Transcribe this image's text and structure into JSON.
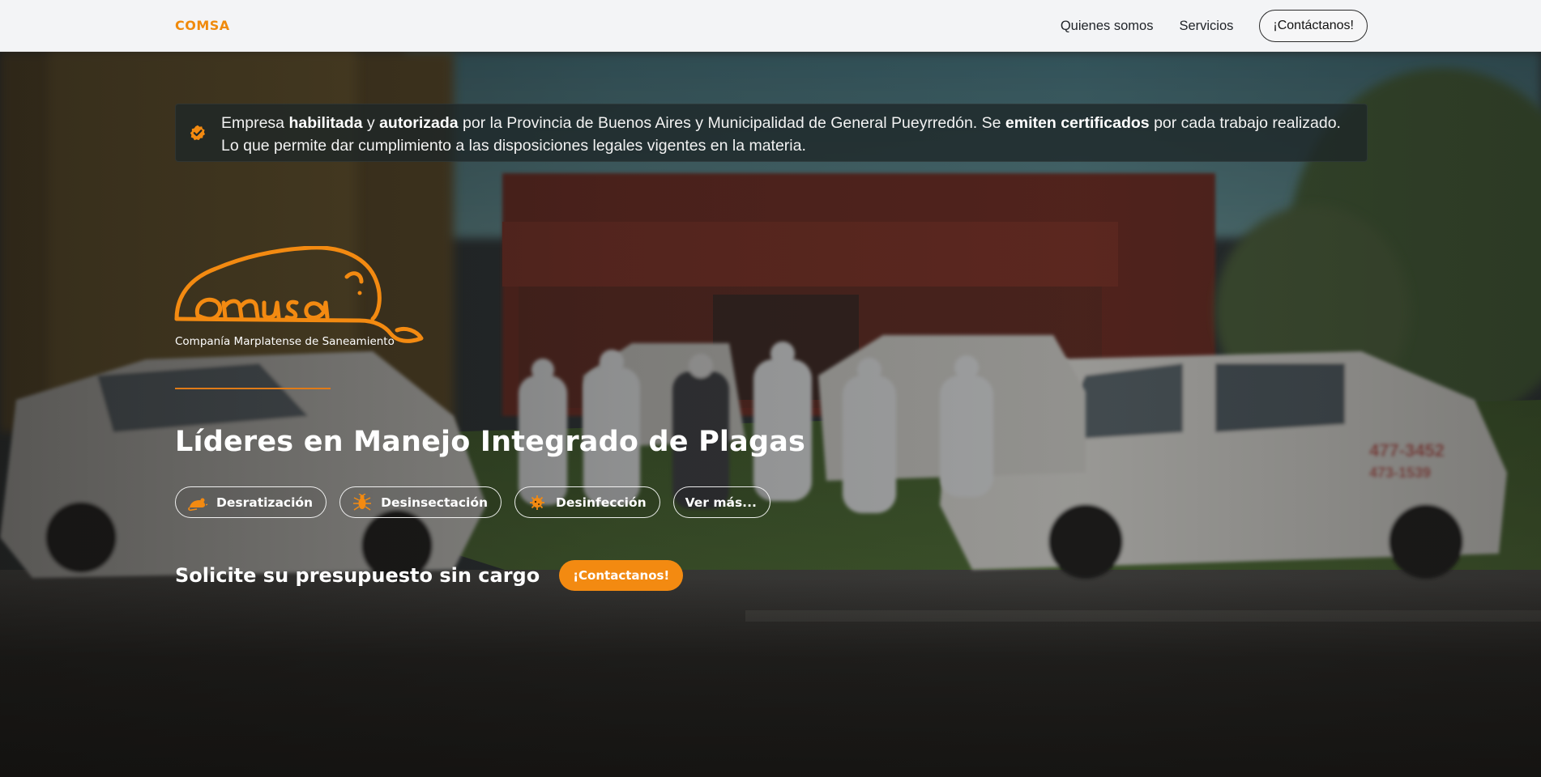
{
  "navbar": {
    "brand": "COMSA",
    "links": [
      "Quienes somos",
      "Servicios"
    ],
    "cta_label": "¡Contáctanos!"
  },
  "notice": {
    "icon": "check-badge-icon",
    "parts": [
      {
        "t": "Empresa ",
        "b": false
      },
      {
        "t": "habilitada",
        "b": true
      },
      {
        "t": " y ",
        "b": false
      },
      {
        "t": "autorizada",
        "b": true
      },
      {
        "t": " por la Provincia de Buenos Aires y Municipalidad de General Pueyrredón. Se ",
        "b": false
      },
      {
        "t": "emiten certificados",
        "b": true
      },
      {
        "t": " por cada trabajo realizado. Lo que permite dar cumplimiento a las disposiciones legales vigentes en la materia.",
        "b": false
      }
    ]
  },
  "logo": {
    "caption": "Companía Marplatense de Saneamiento"
  },
  "hero": {
    "headline": "Líderes en Manejo Integrado de Plagas",
    "services": [
      {
        "label": "Desratización",
        "icon": "rat-icon"
      },
      {
        "label": "Desinsectación",
        "icon": "insect-icon"
      },
      {
        "label": "Desinfección",
        "icon": "virus-icon"
      },
      {
        "label": "Ver más...",
        "icon": ""
      }
    ],
    "cta_text": "Solicite su presupuesto sin cargo",
    "cta_button": "¡Contactanos!"
  },
  "colors": {
    "accent": "#f38a11",
    "nav_bg": "#f3f4f6",
    "notice_bg": "#1e2628"
  }
}
